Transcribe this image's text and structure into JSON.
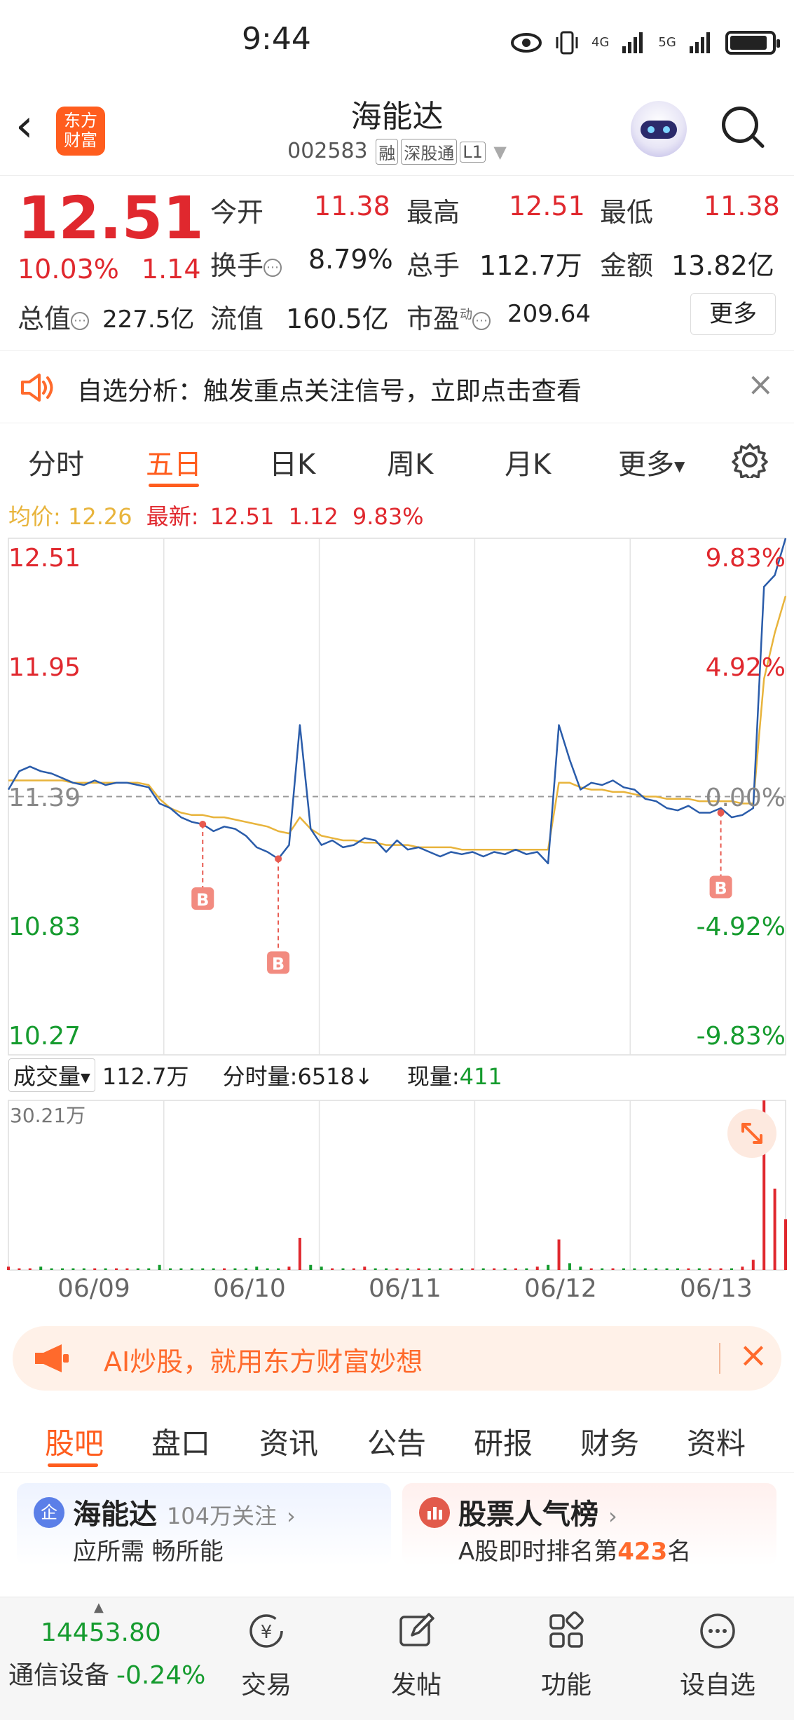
{
  "status_bar": {
    "time": "9:44",
    "signal1": "4G",
    "signal2": "5G"
  },
  "header": {
    "logo_line1": "东方",
    "logo_line2": "财富",
    "title": "海能达",
    "code": "002583",
    "tags": [
      "融",
      "深股通",
      "L1"
    ]
  },
  "quote": {
    "price": "12.51",
    "change_pct": "10.03%",
    "change_amt": "1.14",
    "open_label": "今开",
    "open": "11.38",
    "high_label": "最高",
    "high": "12.51",
    "low_label": "最低",
    "low": "11.38",
    "turnover_label": "换手",
    "turnover": "8.79%",
    "volume_label": "总手",
    "volume": "112.7万",
    "amount_label": "金额",
    "amount": "13.82亿",
    "mktcap_label": "总值",
    "mktcap": "227.5亿",
    "float_label": "流值",
    "float_cap": "160.5亿",
    "pe_label": "市盈",
    "pe_sup": "动",
    "pe": "209.64",
    "more_label": "更多"
  },
  "alert": {
    "text": "自选分析：触发重点关注信号，立即点击查看"
  },
  "chart_tabs": [
    "分时",
    "五日",
    "日K",
    "周K",
    "月K",
    "更多"
  ],
  "avg_line": {
    "avg_label": "均价:",
    "avg": "12.26",
    "latest_label": "最新:",
    "latest": "12.51",
    "latest_chg": "1.12",
    "latest_pct": "9.83%"
  },
  "volume_bar": {
    "selector": "成交量",
    "total": "112.7万",
    "tick_label": "分时量:",
    "tick": "6518↓",
    "current_label": "现量:",
    "current": "411",
    "max_label": "30.21万"
  },
  "chart_data": {
    "type": "line",
    "title": "",
    "x": [
      "06/09",
      "06/10",
      "06/11",
      "06/12",
      "06/13"
    ],
    "ylim": [
      10.27,
      12.51
    ],
    "y_ticks_left": [
      "12.51",
      "11.95",
      "11.39",
      "10.83",
      "10.27"
    ],
    "y_ticks_right": [
      "9.83%",
      "4.92%",
      "0.00%",
      "-4.92%",
      "-9.83%"
    ],
    "prev_close": 11.39,
    "series": [
      {
        "name": "",
        "color": "#2a5caa",
        "values": [
          11.42,
          11.5,
          11.52,
          11.5,
          11.49,
          11.47,
          11.45,
          11.44,
          11.46,
          11.44,
          11.45,
          11.45,
          11.44,
          11.43,
          11.36,
          11.34,
          11.3,
          11.28,
          11.27,
          11.24,
          11.26,
          11.25,
          11.22,
          11.17,
          11.15,
          11.12,
          11.18,
          11.7,
          11.25,
          11.18,
          11.2,
          11.17,
          11.18,
          11.21,
          11.2,
          11.15,
          11.2,
          11.16,
          11.17,
          11.15,
          11.13,
          11.15,
          11.14,
          11.15,
          11.13,
          11.15,
          11.14,
          11.16,
          11.14,
          11.15,
          11.1,
          11.7,
          11.55,
          11.42,
          11.45,
          11.44,
          11.46,
          11.43,
          11.42,
          11.38,
          11.37,
          11.34,
          11.33,
          11.35,
          11.32,
          11.32,
          11.34,
          11.3,
          11.31,
          11.34,
          12.3,
          12.35,
          12.51
        ]
      },
      {
        "name": "",
        "color": "#e8b43c",
        "values": [
          11.46,
          11.46,
          11.46,
          11.46,
          11.46,
          11.46,
          11.45,
          11.45,
          11.45,
          11.45,
          11.45,
          11.45,
          11.45,
          11.44,
          11.38,
          11.34,
          11.32,
          11.31,
          11.31,
          11.3,
          11.3,
          11.29,
          11.28,
          11.27,
          11.26,
          11.24,
          11.23,
          11.3,
          11.25,
          11.22,
          11.21,
          11.2,
          11.2,
          11.19,
          11.19,
          11.18,
          11.18,
          11.18,
          11.17,
          11.17,
          11.17,
          11.17,
          11.16,
          11.16,
          11.16,
          11.16,
          11.16,
          11.16,
          11.16,
          11.16,
          11.16,
          11.45,
          11.45,
          11.43,
          11.42,
          11.42,
          11.41,
          11.41,
          11.4,
          11.39,
          11.39,
          11.38,
          11.38,
          11.38,
          11.37,
          11.37,
          11.37,
          11.37,
          11.36,
          11.36,
          11.9,
          12.1,
          12.26
        ]
      }
    ],
    "volume": [
      2,
      1,
      1,
      2,
      1,
      1,
      1,
      1,
      1,
      1,
      1,
      1,
      1,
      1,
      3,
      1,
      1,
      1,
      1,
      1,
      1,
      1,
      1,
      2,
      1,
      1,
      2,
      19,
      3,
      2,
      1,
      1,
      1,
      2,
      1,
      1,
      1,
      1,
      1,
      1,
      1,
      1,
      1,
      1,
      1,
      1,
      1,
      1,
      1,
      2,
      3,
      18,
      4,
      2,
      1,
      1,
      1,
      1,
      1,
      1,
      1,
      1,
      1,
      1,
      1,
      1,
      1,
      1,
      2,
      6,
      100,
      48,
      30
    ],
    "volume_max": "30.21万",
    "markers": [
      {
        "label": "B",
        "x_index": 18,
        "price": 11.27
      },
      {
        "label": "B",
        "x_index": 25,
        "price": 11.12
      },
      {
        "label": "B",
        "x_index": 66,
        "price": 11.32
      }
    ]
  },
  "ai_banner": {
    "text": "AI炒股，就用东方财富妙想"
  },
  "bottom_tabs": [
    "股吧",
    "盘口",
    "资讯",
    "公告",
    "研报",
    "财务",
    "资料"
  ],
  "cards": {
    "stock": {
      "icon": "企",
      "name": "海能达",
      "follow": "104万关注",
      "slogan": "应所需 畅所能"
    },
    "rank": {
      "title": "股票人气榜",
      "sub_prefix": "A股即时排名第",
      "rank": "423",
      "sub_suffix": "名"
    }
  },
  "bottom_nav": {
    "index_value": "14453.80",
    "index_name": "通信设备",
    "index_chg": "-0.24%",
    "items": [
      "交易",
      "发帖",
      "功能",
      "设自选"
    ]
  }
}
